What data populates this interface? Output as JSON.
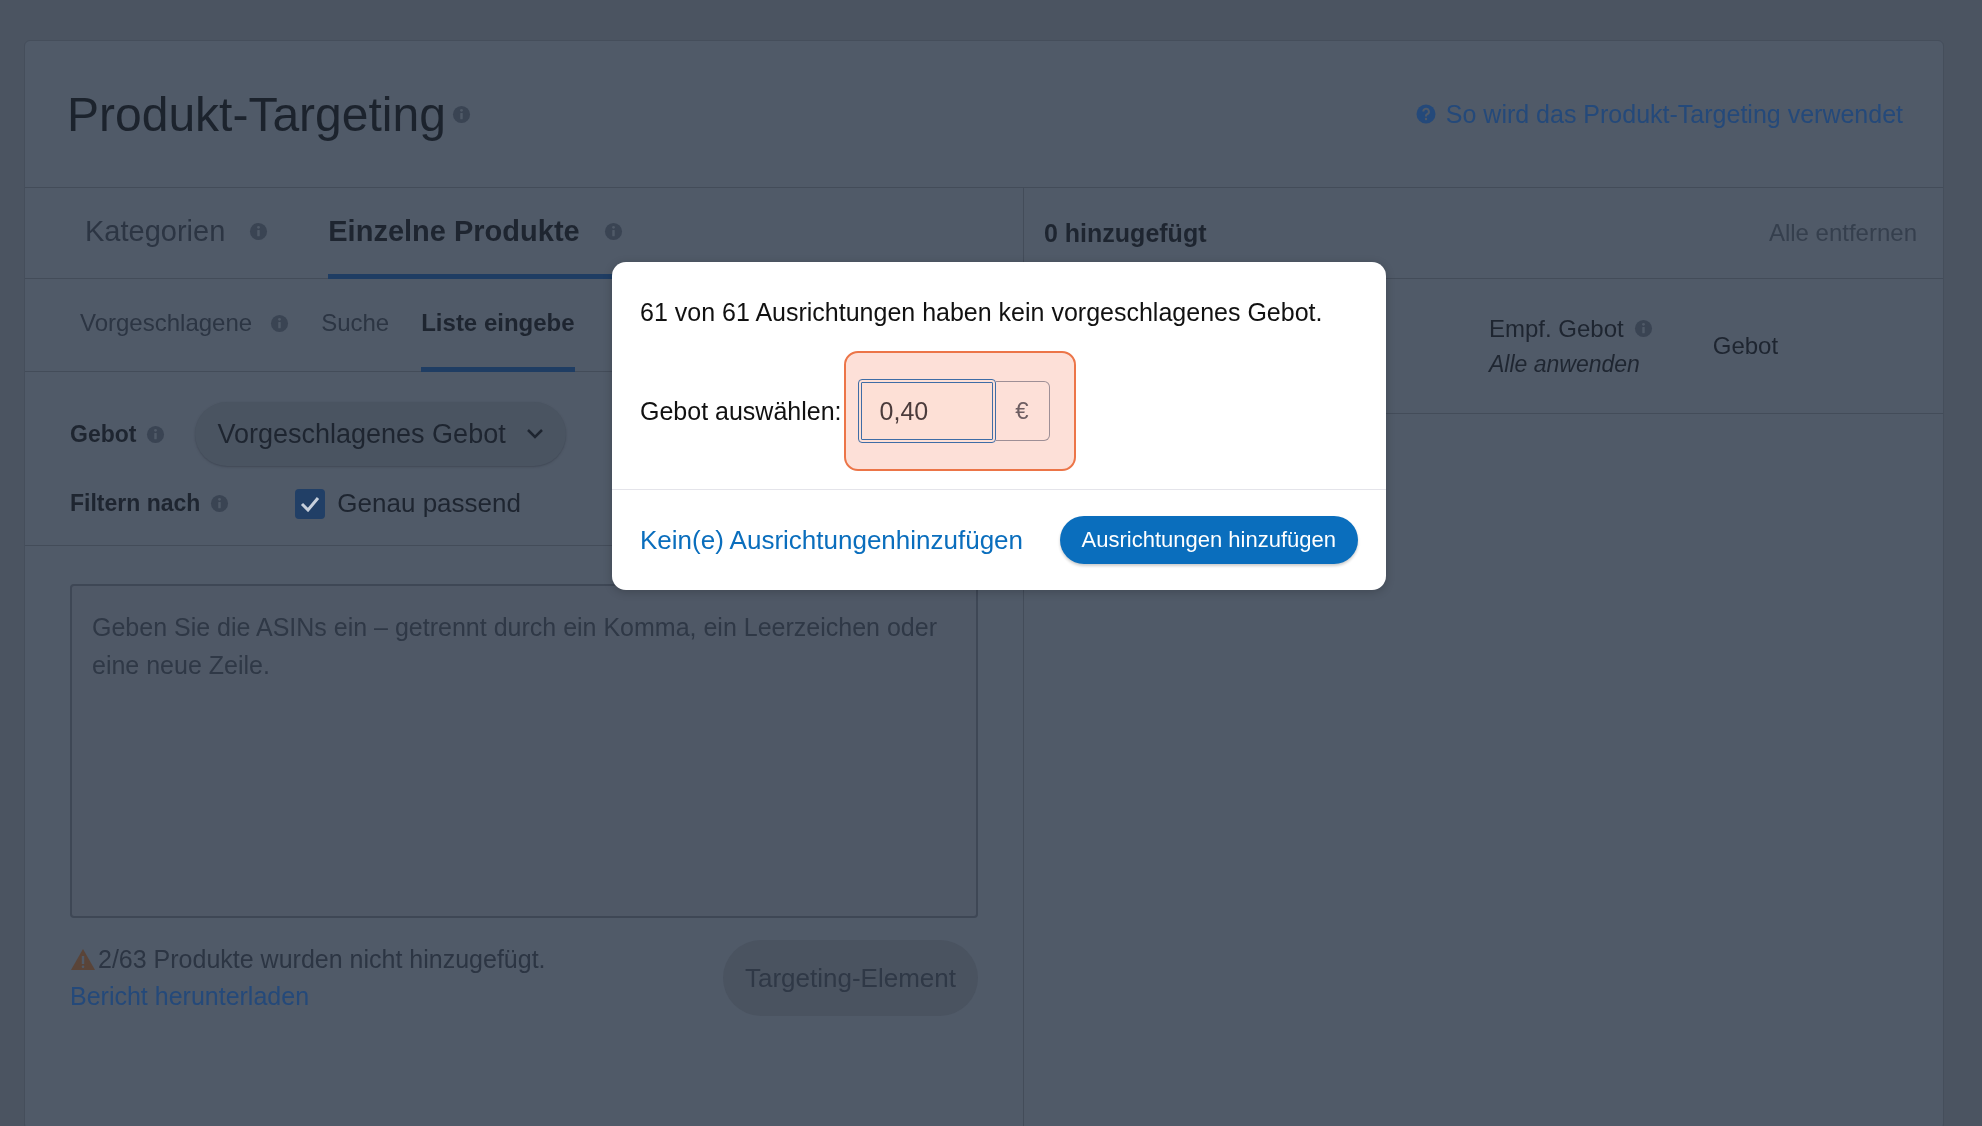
{
  "header": {
    "title": "Produkt-Targeting",
    "help_link": "So wird das Produkt-Targeting verwendet"
  },
  "tabs": [
    {
      "label": "Kategorien",
      "selected": false,
      "info": true
    },
    {
      "label": "Einzelne Produkte",
      "selected": true,
      "info": true
    }
  ],
  "subtabs": [
    {
      "label": "Vorgeschlagene",
      "selected": false,
      "info": true
    },
    {
      "label": "Suche",
      "selected": false,
      "info": false
    },
    {
      "label": "Liste eingebe",
      "selected": true,
      "info": false
    }
  ],
  "bid": {
    "label": "Gebot",
    "dropdown": "Vorgeschlagenes Gebot"
  },
  "filter": {
    "label": "Filtern nach",
    "options": [
      {
        "label": "Genau passend",
        "checked": true
      }
    ]
  },
  "asin_input": {
    "placeholder": "Geben Sie die ASINs ein – getrennt durch ein Komma, ein Leerzeichen oder eine neue Zeile."
  },
  "warning": {
    "text": "2/63 Produkte wurden nicht hinzugefügt.",
    "link": "Bericht herunterladen"
  },
  "add_button": {
    "label": "Targeting-Element",
    "disabled": true
  },
  "added_panel": {
    "count": "0 hinzugefügt",
    "remove_all": "Alle entfernen",
    "columns": [
      {
        "label": "Empf. Gebot",
        "sublabel": "Alle anwenden",
        "info": true
      },
      {
        "label": "Gebot",
        "info": false
      }
    ]
  },
  "modal": {
    "message": "61 von 61 Ausrichtungen haben kein vorgeschlagenes Gebot.",
    "bid_label": "Gebot auswählen:",
    "bid_value": "0,40",
    "currency": "€",
    "highlighted": true,
    "secondary_button": "Kein(e) Ausrichtungenhinzufügen",
    "primary_button": "Ausrichtungen hinzufügen"
  }
}
